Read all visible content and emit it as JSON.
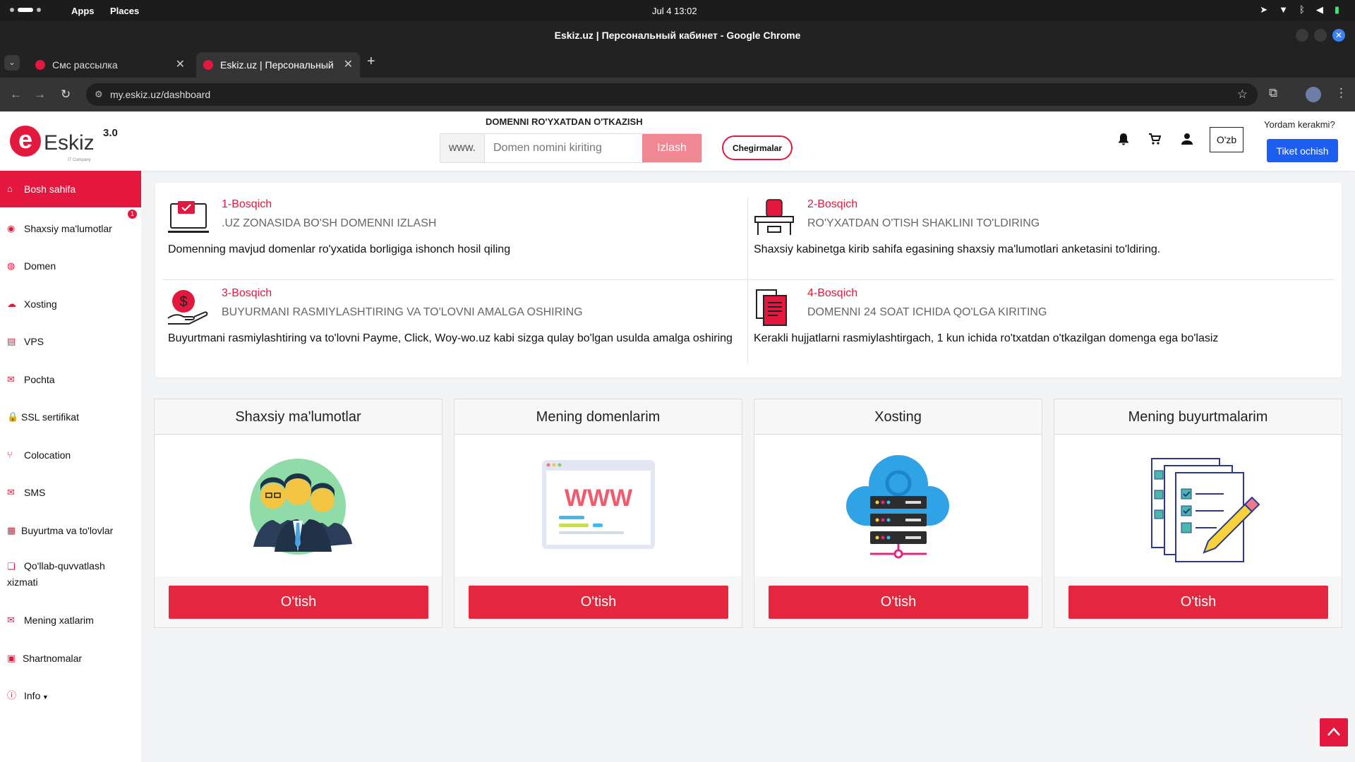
{
  "os": {
    "apps": "Apps",
    "places": "Places",
    "clock": "Jul 4  13:02"
  },
  "window": {
    "title": "Eskiz.uz | Персональный кабинет - Google Chrome"
  },
  "tabs": [
    {
      "title": "Смс рассылка"
    },
    {
      "title": "Eskiz.uz | Персональный"
    }
  ],
  "address": {
    "url": "my.eskiz.uz/dashboard"
  },
  "header": {
    "logo_name": "Eskiz",
    "logo_sub": "IT Company",
    "version": "3.0",
    "domain_title": "DOMENNI RO'YXATDAN O'TKAZISH",
    "www_prefix": "www.",
    "search_placeholder": "Domen nomini kiriting",
    "search_button": "Izlash",
    "discounts_button": "Chegirmalar",
    "lang_button": "O'zb",
    "help_text": "Yordam kerakmi?",
    "ticket_button": "Tiket ochish"
  },
  "sidebar": {
    "items": [
      {
        "label": "Bosh sahifa",
        "icon": "home-icon"
      },
      {
        "label": "Shaxsiy ma'lumotlar",
        "icon": "user-circle-icon"
      },
      {
        "label": "Domen",
        "icon": "globe-icon"
      },
      {
        "label": "Xosting",
        "icon": "cloud-icon"
      },
      {
        "label": "VPS",
        "icon": "server-icon"
      },
      {
        "label": "Pochta",
        "icon": "mail-icon"
      },
      {
        "label": "SSL sertifikat",
        "icon": "lock-icon"
      },
      {
        "label": "Colocation",
        "icon": "branch-icon"
      },
      {
        "label": "SMS",
        "icon": "envelope-icon"
      },
      {
        "label": "Buyurtma va to'lovlar",
        "icon": "calculator-icon"
      },
      {
        "label": "Qo'llab-quvvatlash xizmati",
        "icon": "chat-icon"
      },
      {
        "label": "Mening xatlarim",
        "icon": "envelope-icon"
      },
      {
        "label": "Shartnomalar",
        "icon": "clipboard-icon"
      },
      {
        "label": "Info",
        "icon": "info-icon"
      }
    ],
    "badge": "1"
  },
  "steps": [
    {
      "num": "1-Bosqich",
      "title": ".UZ ZONASIDA BO'SH DOMENNI IZLASH",
      "desc": "Domenning mavjud domenlar ro'yxatida borligiga ishonch hosil qiling"
    },
    {
      "num": "2-Bosqich",
      "title": "RO'YXATDAN O'TISH SHAKLINI TO'LDIRING",
      "desc": "Shaxsiy kabinetga kirib sahifa egasining shaxsiy ma'lumotlari anketasini to'ldiring."
    },
    {
      "num": "3-Bosqich",
      "title": "BUYURMANI RASMIYLASHTIRING VA TO'LOVNI AMALGA OSHIRING",
      "desc": "Buyurtmani rasmiylashtiring va to'lovni Payme, Click, Woy-wo.uz kabi sizga qulay bo'lgan usulda amalga oshiring"
    },
    {
      "num": "4-Bosqich",
      "title": "DOMENNI 24 SOAT ICHIDA QO'LGA KIRITING",
      "desc": "Kerakli hujjatlarni rasmiylashtirgach, 1 kun ichida ro'txatdan o'tkazilgan domenga ega bo'lasiz"
    }
  ],
  "cards": [
    {
      "title": "Shaxsiy ma'lumotlar",
      "button": "O'tish"
    },
    {
      "title": "Mening domenlarim",
      "button": "O'tish",
      "illustration_text": "WWW"
    },
    {
      "title": "Xosting",
      "button": "O'tish"
    },
    {
      "title": "Mening buyurtmalarim",
      "button": "O'tish"
    }
  ],
  "colors": {
    "brand": "#e4173e",
    "ticket": "#1b5ef0"
  }
}
